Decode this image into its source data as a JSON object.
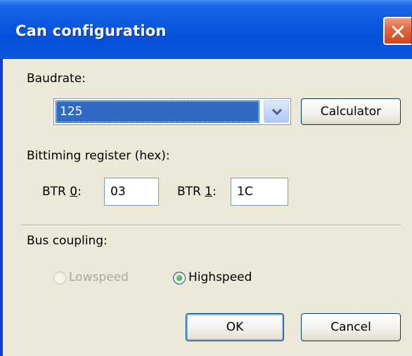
{
  "window": {
    "title": "Can configuration"
  },
  "baudrate": {
    "label": "Baudrate:",
    "selected": "125",
    "calculator_label": "Calculator"
  },
  "bittiming": {
    "label": "Bittiming register (hex):",
    "btr0": {
      "label_prefix": "BTR ",
      "label_mnemonic": "0",
      "label_suffix": ":",
      "value": "03"
    },
    "btr1": {
      "label_prefix": "BTR ",
      "label_mnemonic": "1",
      "label_suffix": ":",
      "value": "1C"
    }
  },
  "bus": {
    "label": "Bus coupling:",
    "lowspeed_label": "Lowspeed",
    "highspeed_label": "Highspeed",
    "selected": "Highspeed",
    "lowspeed_enabled": false
  },
  "actions": {
    "ok_label": "OK",
    "cancel_label": "Cancel"
  },
  "icons": {
    "close": "close-icon",
    "dropdown": "chevron-down-icon"
  },
  "colors": {
    "titlebar": "#0a56df",
    "dialog_bg": "#ece9d8",
    "selection": "#316ac5",
    "close_button": "#e26a43",
    "disabled_text": "#aca899"
  }
}
